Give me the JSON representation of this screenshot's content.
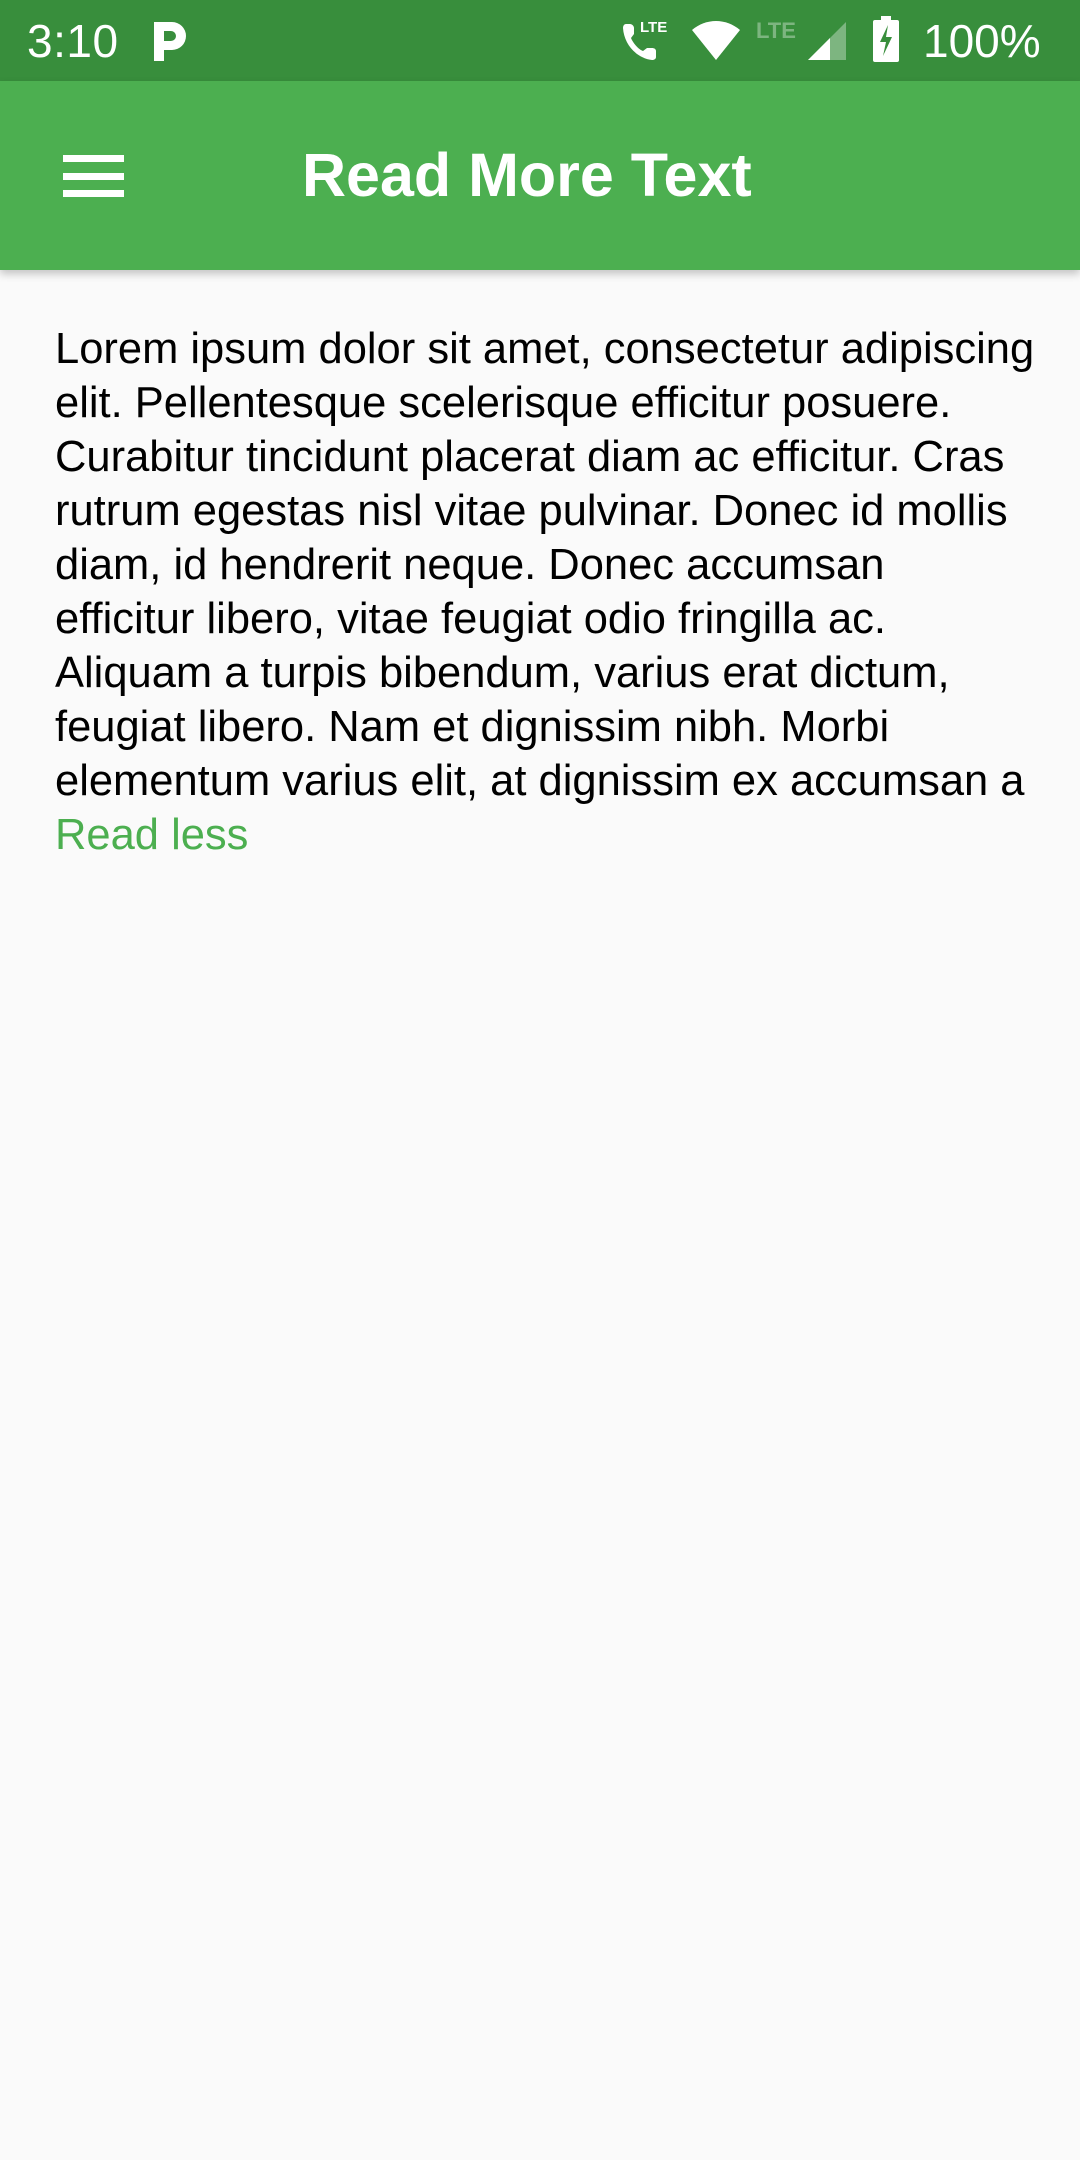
{
  "status_bar": {
    "time": "3:10",
    "notification_icon": "p-app-icon",
    "icons": [
      "call-lte-icon",
      "wifi-icon",
      "lte-icon",
      "signal-icon",
      "battery-charging-icon"
    ],
    "call_lte_label": "LTE",
    "lte_label": "LTE",
    "battery_percent": "100%"
  },
  "app_bar": {
    "title": "Read More Text",
    "menu_icon": "hamburger-menu-icon",
    "background_color": "#4CAF50"
  },
  "content": {
    "body_text": "Lorem ipsum dolor sit amet, consectetur adipiscing elit. Pellentesque scelerisque efficitur posuere. Curabitur tincidunt placerat diam ac efficitur. Cras rutrum egestas nisl vitae pulvinar. Donec id mollis diam, id hendrerit neque. Donec accumsan efficitur libero, vitae feugiat odio fringilla ac. Aliquam a turpis bibendum, varius erat dictum, feugiat libero. Nam et dignissim nibh. Morbi elementum varius elit, at dignissim ex accumsan a",
    "toggle_label": "Read less",
    "toggle_color": "#4CAF50"
  }
}
